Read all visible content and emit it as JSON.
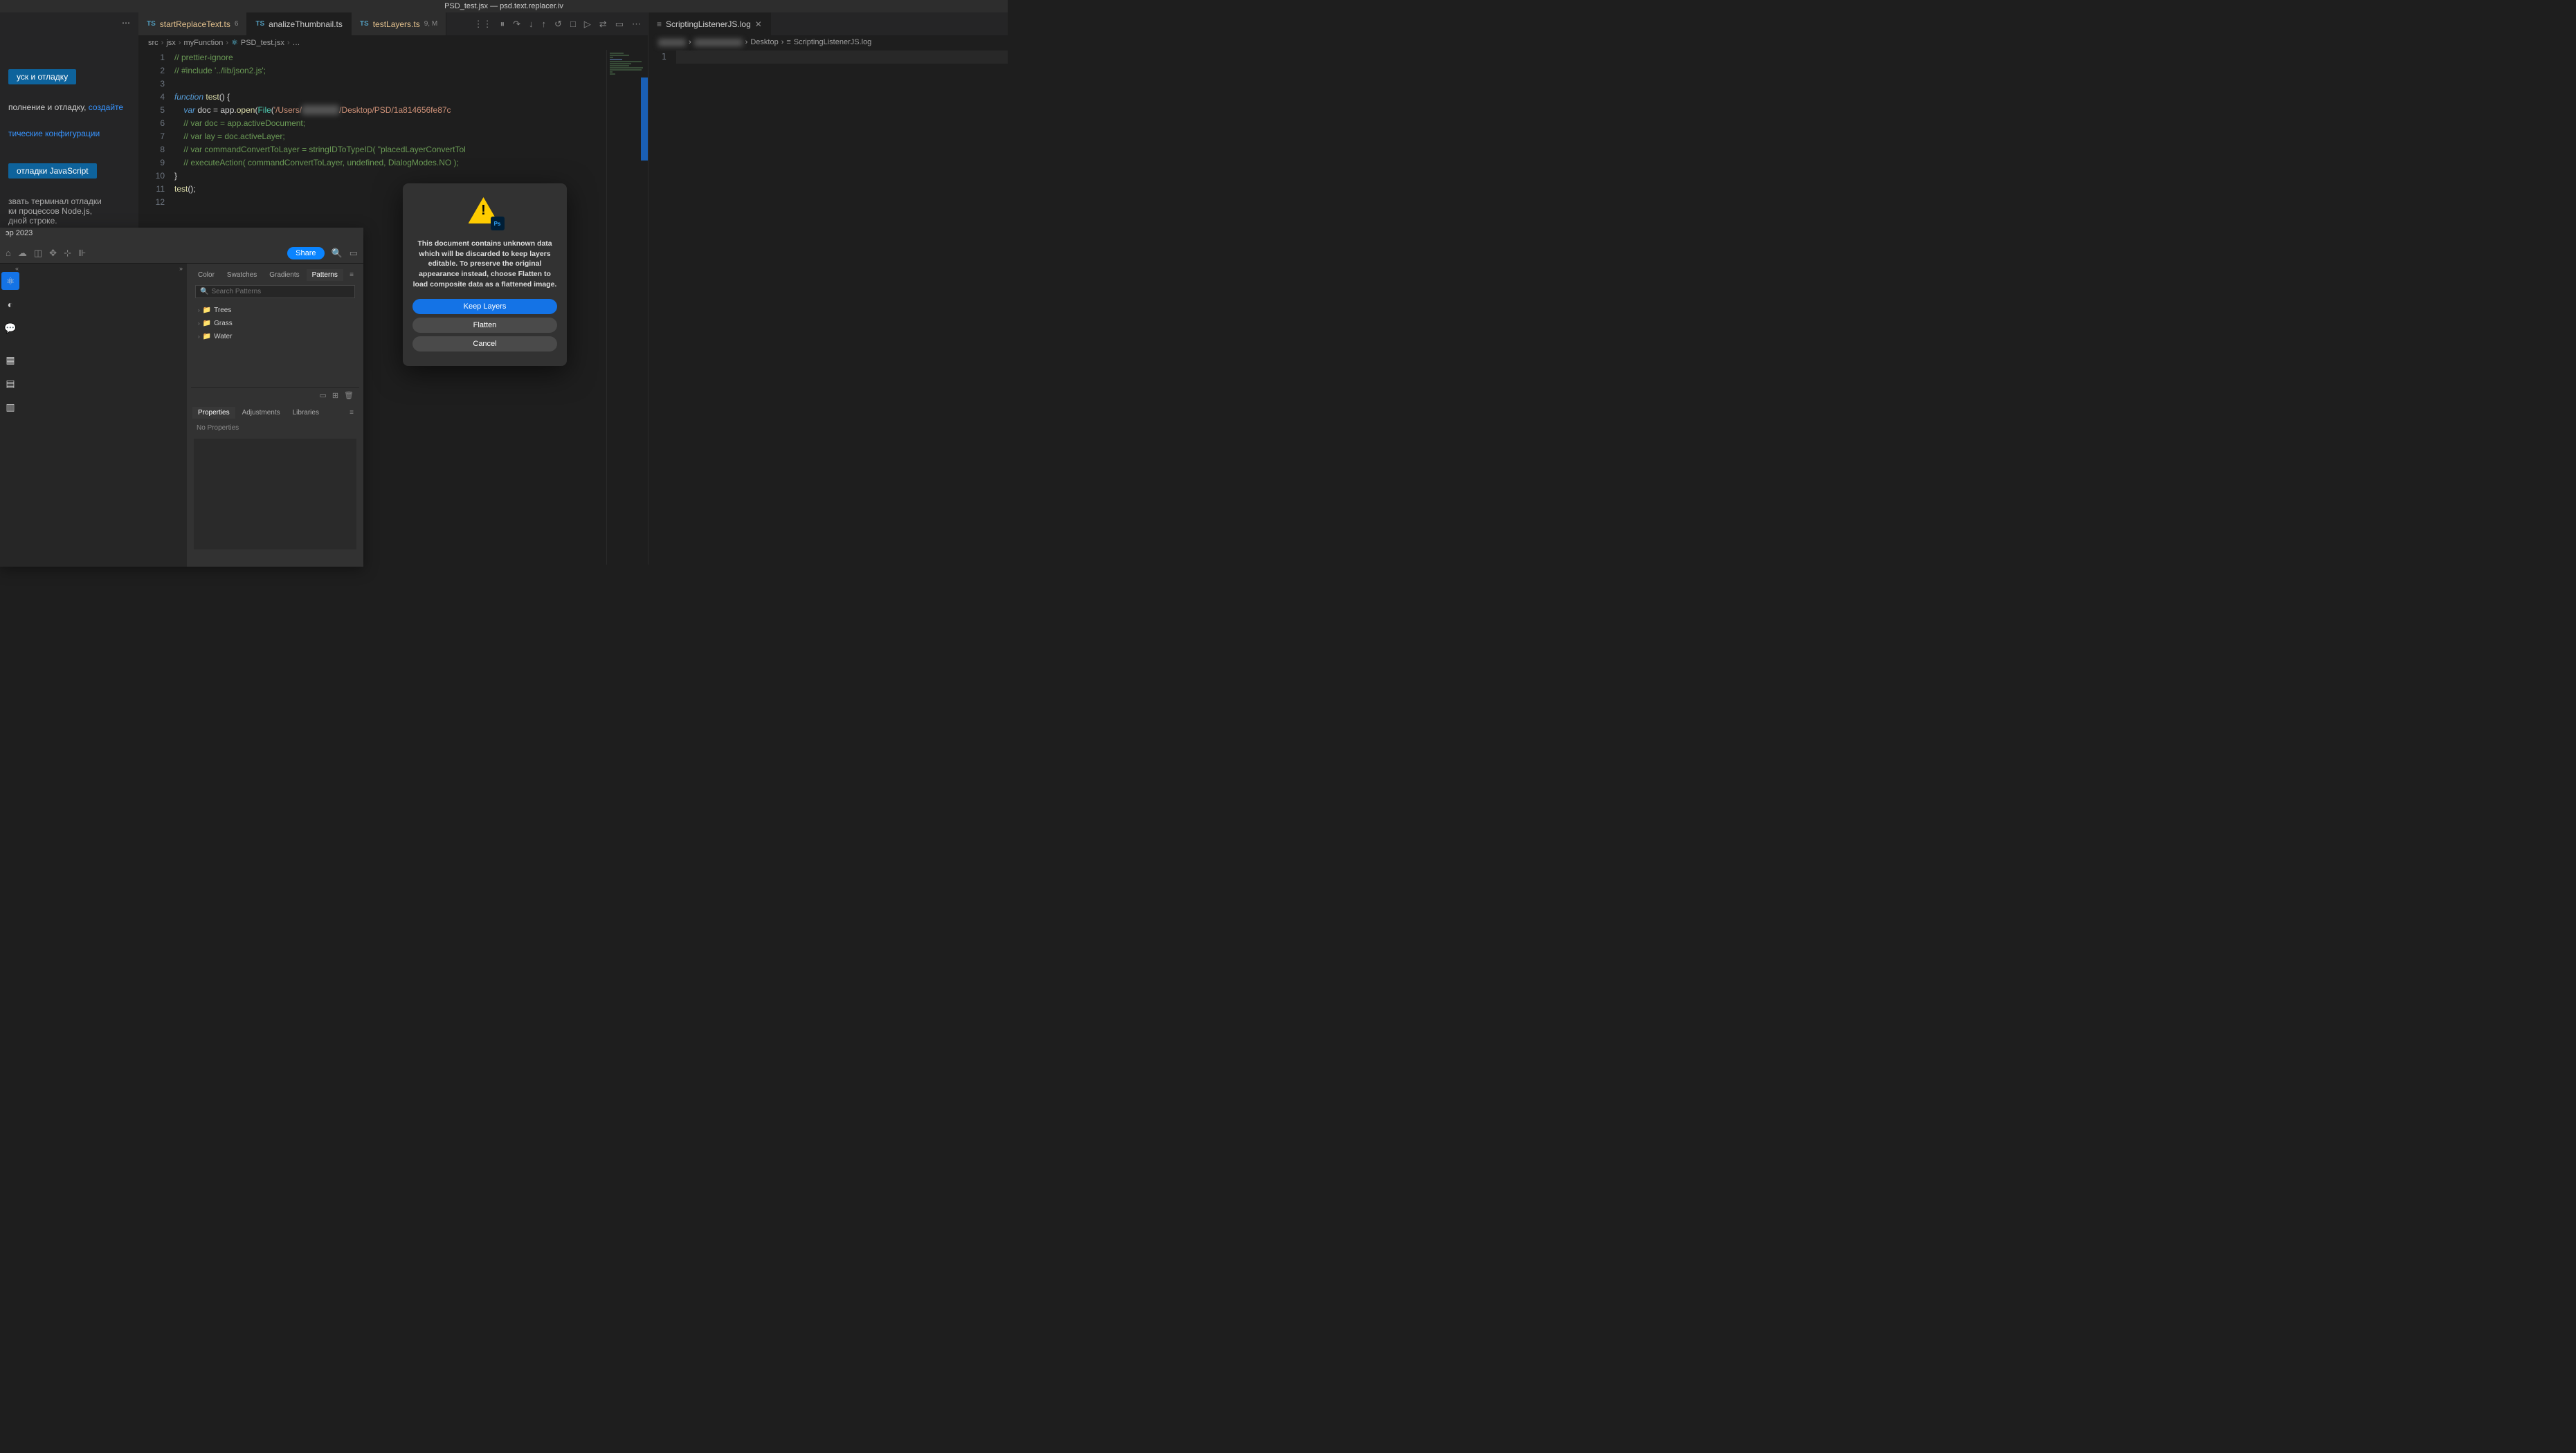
{
  "window_title": "PSD_test.jsx — psd.text.replacer.iv",
  "tabs": [
    {
      "icon": "TS",
      "name": "startReplaceText.ts",
      "badge": "6",
      "active": false,
      "name_class": "tab-name"
    },
    {
      "icon": "TS",
      "name": "analizeThumbnail.ts",
      "badge": "",
      "active": true,
      "name_class": "green"
    },
    {
      "icon": "TS",
      "name": "testLayers.ts",
      "badge": "9, M",
      "active": false,
      "name_class": "tab-name"
    }
  ],
  "toolbar_icons": [
    "⋮⋮",
    "⏸",
    "↷",
    "↓",
    "↑",
    "↺",
    "□",
    "▷",
    "⇄",
    "▭",
    "⋯"
  ],
  "breadcrumb": [
    "src",
    "jsx",
    "myFunction",
    "PSD_test.jsx",
    "…"
  ],
  "code_lines": [
    {
      "n": 1,
      "html": "<span class='c'>// prettier-ignore</span>"
    },
    {
      "n": 2,
      "html": "<span class='c'>// #include '../lib/json2.js';</span>"
    },
    {
      "n": 3,
      "html": ""
    },
    {
      "n": 4,
      "html": "<span class='kw'>function</span> <span class='fn'>test</span>() {"
    },
    {
      "n": 5,
      "html": "    <span class='kw'>var</span> doc <span class='op'>=</span> app.<span class='fn'>open</span>(<span class='tp'>File</span>(<span class='st'>'/Users/</span><span class='blur'>xxxxxxxxx</span><span class='st'>/Desktop/PSD/1a814656fe87c</span>"
    },
    {
      "n": 6,
      "html": "    <span class='c'>// var doc = app.activeDocument;</span>"
    },
    {
      "n": 7,
      "html": "    <span class='c'>// var lay = doc.activeLayer;</span>"
    },
    {
      "n": 8,
      "html": "    <span class='c'>// var commandConvertToLayer = stringIDToTypeID( \"placedLayerConvertTol</span>"
    },
    {
      "n": 9,
      "html": "    <span class='c'>// executeAction( commandConvertToLayer, undefined, DialogModes.NO );</span>"
    },
    {
      "n": 10,
      "html": "}"
    },
    {
      "n": 11,
      "html": "<span class='fn'>test</span>();"
    },
    {
      "n": 12,
      "html": ""
    }
  ],
  "left_panel": {
    "text1_prefix": "уск и отладку",
    "text2_prefix": "полнение и отладку, ",
    "create_link": "создайте",
    "config_link": "тические конфигурации",
    "js_debug_btn": "отладки JavaScript",
    "help_text1": "звать терминал отладки",
    "help_text2": "ки процессов Node.js,",
    "help_text3": "дной строке."
  },
  "right_pane": {
    "tab_name": "ScriptingListenerJS.log",
    "breadcrumb": [
      "Desktop",
      "ScriptingListenerJS.log"
    ],
    "line_number": "1"
  },
  "photoshop": {
    "title": "эр 2023",
    "share": "Share",
    "panel1_tabs": [
      "Color",
      "Swatches",
      "Gradients",
      "Patterns"
    ],
    "search_placeholder": "Search Patterns",
    "tree": [
      "Trees",
      "Grass",
      "Water"
    ],
    "panel2_tabs": [
      "Properties",
      "Adjustments",
      "Libraries"
    ],
    "no_props": "No Properties",
    "footer_icons": [
      "▭",
      "⊞",
      "🗑"
    ]
  },
  "dialog": {
    "message": "This document contains unknown data which will be discarded to keep layers editable. To preserve the original appearance instead, choose Flatten to load composite data as a flattened image.",
    "keep": "Keep Layers",
    "flatten": "Flatten",
    "cancel": "Cancel"
  }
}
